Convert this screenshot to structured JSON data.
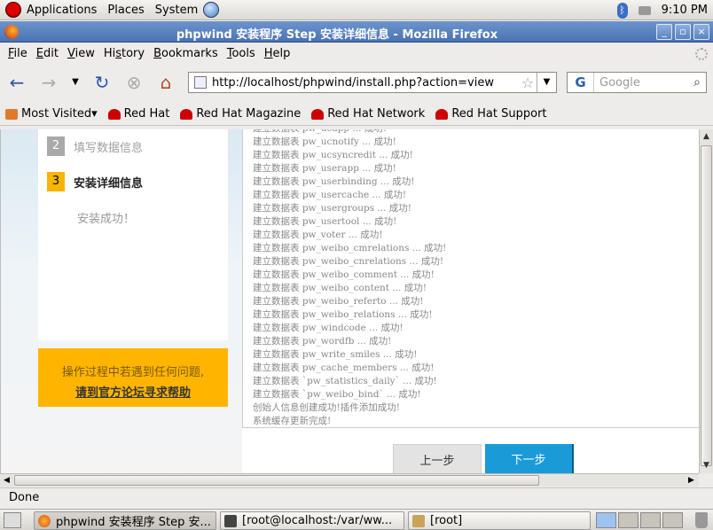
{
  "top_panel": {
    "menus": [
      "Applications",
      "Places",
      "System"
    ],
    "clock": "9:10 PM"
  },
  "window": {
    "title": "phpwind 安装程序 Step 安装详细信息 - Mozilla Firefox",
    "buttons": [
      "_",
      "▫",
      "×"
    ]
  },
  "menubar": {
    "items": [
      {
        "mnemonic": "F",
        "rest": "ile"
      },
      {
        "mnemonic": "E",
        "rest": "dit"
      },
      {
        "mnemonic": "V",
        "rest": "iew"
      },
      {
        "mnemonic": "H",
        "rest": "istory",
        "pre": "Hi",
        "post": "tory"
      },
      {
        "mnemonic": "B",
        "rest": "ookmarks"
      },
      {
        "mnemonic": "T",
        "rest": "ools"
      },
      {
        "mnemonic": "H",
        "rest": "elp"
      }
    ]
  },
  "navbar": {
    "url": "http://localhost/phpwind/install.php?action=view",
    "search_placeholder": "Google",
    "search_engine": "G"
  },
  "bookmarks": [
    "Most Visited",
    "Red Hat",
    "Red Hat Magazine",
    "Red Hat Network",
    "Red Hat Support"
  ],
  "installer": {
    "steps": [
      {
        "num": "2",
        "label": "填写数据信息",
        "state": "done"
      },
      {
        "num": "3",
        "label": "安装详细信息",
        "state": "active"
      }
    ],
    "install_success": "安装成功！",
    "help_line1": "操作过程中若遇到任何问题,",
    "help_line2": "请到官方论坛寻求帮助",
    "log": [
      "建立数据表 pw_ucapp ... 成功!",
      "建立数据表 pw_ucnotify ... 成功!",
      "建立数据表 pw_ucsyncredit ... 成功!",
      "建立数据表 pw_userapp ... 成功!",
      "建立数据表 pw_userbinding ... 成功!",
      "建立数据表 pw_usercache ... 成功!",
      "建立数据表 pw_usergroups ... 成功!",
      "建立数据表 pw_usertool ... 成功!",
      "建立数据表 pw_voter ... 成功!",
      "建立数据表 pw_weibo_cmrelations ... 成功!",
      "建立数据表 pw_weibo_cnrelations ... 成功!",
      "建立数据表 pw_weibo_comment ... 成功!",
      "建立数据表 pw_weibo_content ... 成功!",
      "建立数据表 pw_weibo_referto ... 成功!",
      "建立数据表 pw_weibo_relations ... 成功!",
      "建立数据表 pw_windcode ... 成功!",
      "建立数据表 pw_wordfb ... 成功!",
      "建立数据表 pw_write_smiles ... 成功!",
      "建立数据表 pw_cache_members ... 成功!",
      "建立数据表 `pw_statistics_daily` ... 成功!",
      "建立数据表 `pw_weibo_bind` ... 成功!",
      "创始人信息创建成功!插件添加成功!",
      "系统缓存更新完成!"
    ],
    "prev_label": "上一步",
    "next_label": "下一步"
  },
  "status": "Done",
  "taskbar": {
    "tasks": [
      "phpwind 安装程序 Step 安...",
      "[root@localhost:/var/ww...",
      "[root]"
    ]
  },
  "colors": {
    "accent_orange": "#ffb500",
    "next_button": "#1a9bd7",
    "title_bar": "#4a73b3"
  }
}
